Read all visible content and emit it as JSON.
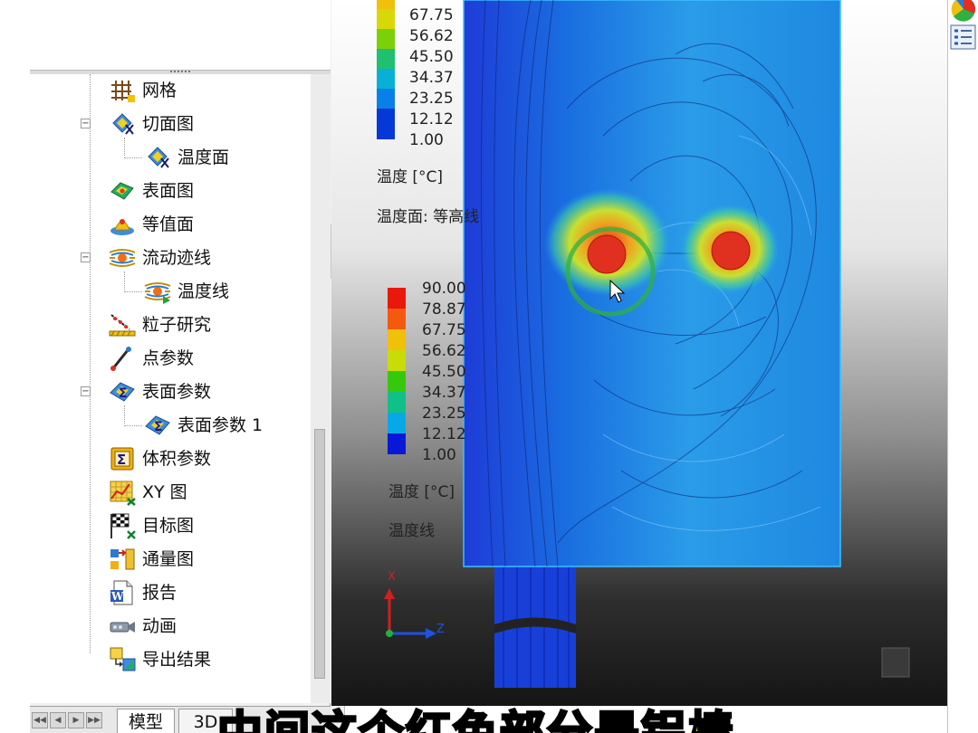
{
  "tree": {
    "items": [
      {
        "label": "网格",
        "icon": "mesh-grid-icon"
      },
      {
        "label": "切面图",
        "icon": "cut-plot-icon"
      },
      {
        "label": "温度面",
        "icon": "cut-plot-icon"
      },
      {
        "label": "表面图",
        "icon": "surface-plot-icon"
      },
      {
        "label": "等值面",
        "icon": "isosurface-icon"
      },
      {
        "label": "流动迹线",
        "icon": "flow-trajectory-icon"
      },
      {
        "label": "温度线",
        "icon": "flow-trajectory-icon"
      },
      {
        "label": "粒子研究",
        "icon": "particle-study-icon"
      },
      {
        "label": "点参数",
        "icon": "point-parameter-icon"
      },
      {
        "label": "表面参数",
        "icon": "surface-parameter-icon"
      },
      {
        "label": "表面参数 1",
        "icon": "surface-parameter-icon"
      },
      {
        "label": "体积参数",
        "icon": "volume-parameter-icon"
      },
      {
        "label": "XY 图",
        "icon": "xy-plot-icon"
      },
      {
        "label": "目标图",
        "icon": "goal-plot-icon"
      },
      {
        "label": "通量图",
        "icon": "flux-plot-icon"
      },
      {
        "label": "报告",
        "icon": "report-icon"
      },
      {
        "label": "动画",
        "icon": "animation-icon"
      },
      {
        "label": "导出结果",
        "icon": "export-results-icon"
      }
    ]
  },
  "tabs": [
    "模型",
    "3D"
  ],
  "legend_top": {
    "ticks": [
      "67.75",
      "56.62",
      "45.50",
      "34.37",
      "23.25",
      "12.12",
      "1.00"
    ],
    "quantity": "温度 [°C]",
    "plot_name": "温度面: 等高线"
  },
  "legend_bottom": {
    "ticks": [
      "90.00",
      "78.87",
      "67.75",
      "56.62",
      "45.50",
      "34.37",
      "23.25",
      "12.12",
      "1.00"
    ],
    "quantity": "温度 [°C]",
    "plot_name": "温度线"
  },
  "triad": {
    "x": "X",
    "z": "Z"
  },
  "colors": {
    "scale": [
      "#e8180c",
      "#f45a0e",
      "#f0c00a",
      "#c8dc08",
      "#36c80c",
      "#10c088",
      "#08a8e8",
      "#0660e0",
      "#0818d8"
    ],
    "domain_blue": "#1a6fe0",
    "hot_spot": "#e03020"
  },
  "caption": "中间这个红色部分是铝棒"
}
